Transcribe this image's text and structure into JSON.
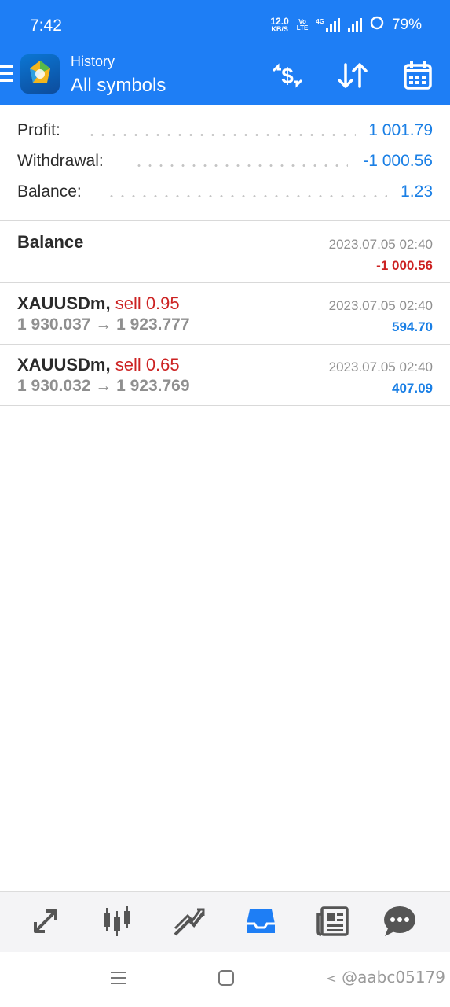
{
  "status_bar": {
    "time": "7:42",
    "net_speed_value": "12.0",
    "net_speed_unit": "KB/S",
    "volte_top": "Vo",
    "volte_bottom": "LTE",
    "network_type": "4G",
    "battery": "79%"
  },
  "app_bar": {
    "title": "History",
    "subtitle": "All symbols",
    "icons": [
      "menu-icon",
      "metatrader-logo",
      "currency-exchange-icon",
      "sort-icon",
      "calendar-icon"
    ]
  },
  "summary": [
    {
      "label": "Profit:",
      "value": "1 001.79"
    },
    {
      "label": "Withdrawal:",
      "value": "-1 000.56"
    },
    {
      "label": "Balance:",
      "value": "1.23"
    }
  ],
  "deals": [
    {
      "symbol": "Balance",
      "type": "",
      "prices": "",
      "date": "2023.07.05 02:40",
      "profit": "-1 000.56",
      "profit_color": "#cc2222"
    },
    {
      "symbol": "XAUUSDm,",
      "type": "sell 0.95",
      "prices": "1 930.037 → 1 923.777",
      "date": "2023.07.05 02:40",
      "profit": "594.70",
      "profit_color": "#1a7fe5"
    },
    {
      "symbol": "XAUUSDm,",
      "type": "sell 0.65",
      "prices": "1 930.032 → 1 923.769",
      "date": "2023.07.05 02:40",
      "profit": "407.09",
      "profit_color": "#1a7fe5"
    }
  ],
  "bottom_nav": {
    "items": [
      "quotes-icon",
      "chart-candles-icon",
      "trade-icon",
      "history-inbox-icon",
      "news-icon",
      "chat-icon"
    ],
    "active": "history-inbox-icon",
    "active_color": "#1e7ef5"
  },
  "watermark": "@aabc05179"
}
